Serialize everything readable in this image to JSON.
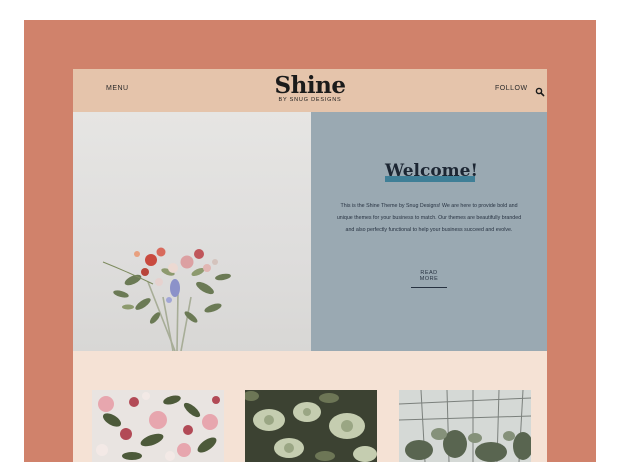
{
  "header": {
    "menu_label": "MENU",
    "follow_label": "FOLLOW",
    "logo_title": "Shine",
    "logo_subtitle": "BY SNUG DESIGNS",
    "search_icon": "search-icon"
  },
  "hero": {
    "image_subject": "flower bouquet",
    "title": "Welcome!",
    "body": "This is the Shine Theme by Snug Designs! We are here to provide bold and unique themes for your business to match. Our themes are beautifully branded and also perfectly functional to help your business succeed and evolve.",
    "cta_label": "READ MORE"
  },
  "cards": [
    {
      "image": "pink roses and berries"
    },
    {
      "image": "hellebore flowers"
    },
    {
      "image": "greenhouse interior"
    }
  ],
  "colors": {
    "frame_background": "#d0826b",
    "header_background": "#e5c4ab",
    "page_background": "#f5e2d5",
    "panel_background": "#9aa9b2",
    "welcome_highlight": "#3f7f97",
    "text_dark": "#1b1b1b"
  }
}
